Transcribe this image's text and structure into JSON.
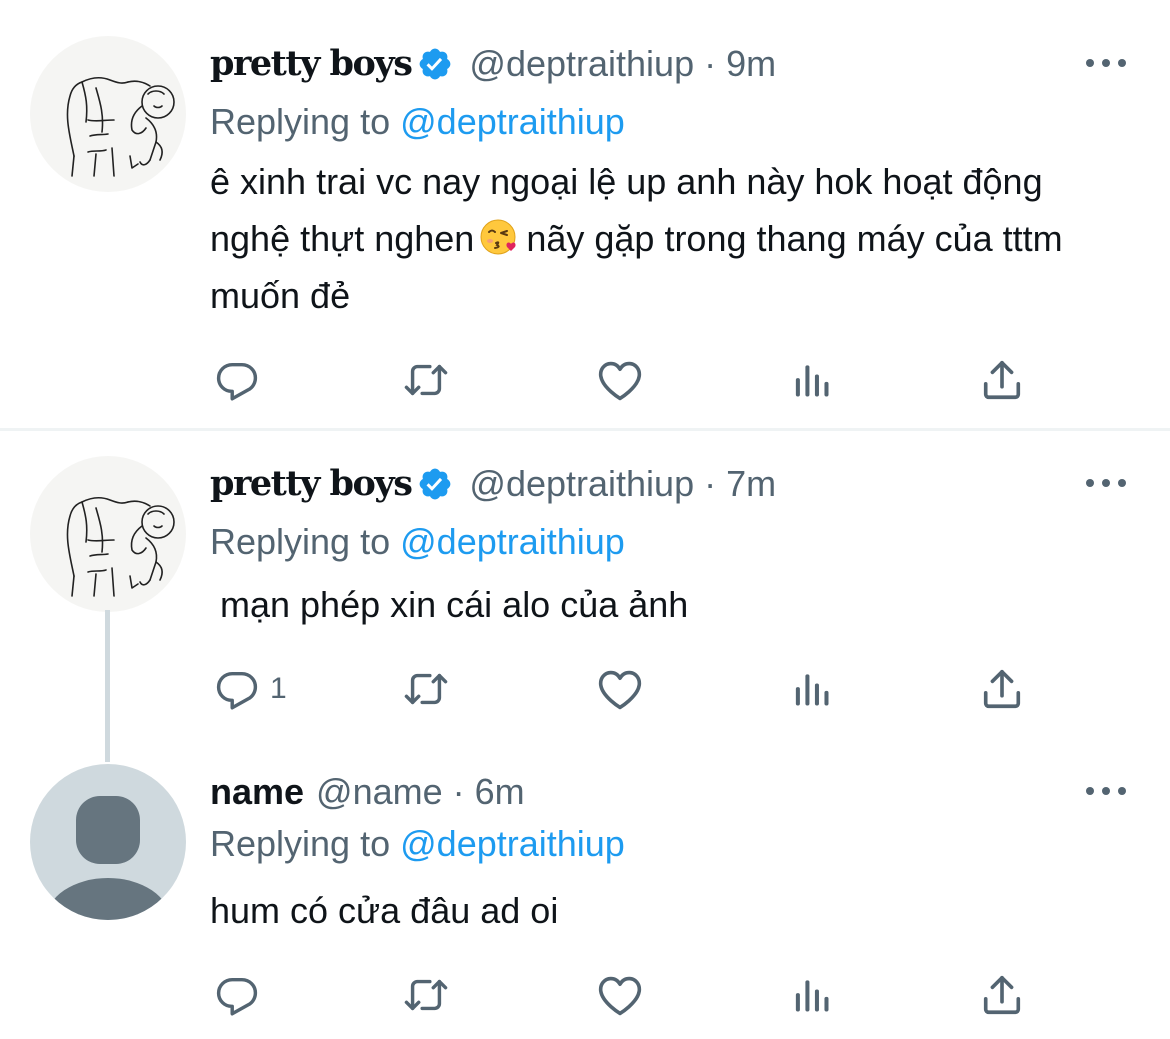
{
  "tweets": [
    {
      "display_name": "pretty boys",
      "verified": true,
      "handle": "@deptraithiup",
      "separator": "·",
      "time": "9m",
      "replying_prefix": "Replying to",
      "replying_to": "@deptraithiup",
      "text_part1": "ê xinh trai vc nay ngoại lệ up anh này hok hoạt động nghệ thựt nghen",
      "emoji": "kissing-heart-emoji",
      "text_part2": "nãy gặp trong thang máy của tttm muốn đẻ",
      "reply_count": ""
    },
    {
      "display_name": "pretty boys",
      "verified": true,
      "handle": "@deptraithiup",
      "separator": "·",
      "time": "7m",
      "replying_prefix": "Replying to",
      "replying_to": "@deptraithiup",
      "text": " mạn phép xin cái alo của ảnh",
      "reply_count": "1"
    },
    {
      "display_name": "name",
      "verified": false,
      "handle": "@name",
      "separator": "·",
      "time": "6m",
      "replying_prefix": "Replying to",
      "replying_to": "@deptraithiup",
      "text": "hum có cửa đâu ad oi",
      "reply_count": ""
    }
  ],
  "colors": {
    "text": "#0f1419",
    "secondary": "#536471",
    "accent": "#1d9bf0",
    "divider": "#eff3f4",
    "default_avatar_bg": "#cfd9de",
    "default_avatar_fg": "#66757f"
  },
  "action_icons": [
    "reply-icon",
    "retweet-icon",
    "like-icon",
    "analytics-icon",
    "share-icon"
  ]
}
